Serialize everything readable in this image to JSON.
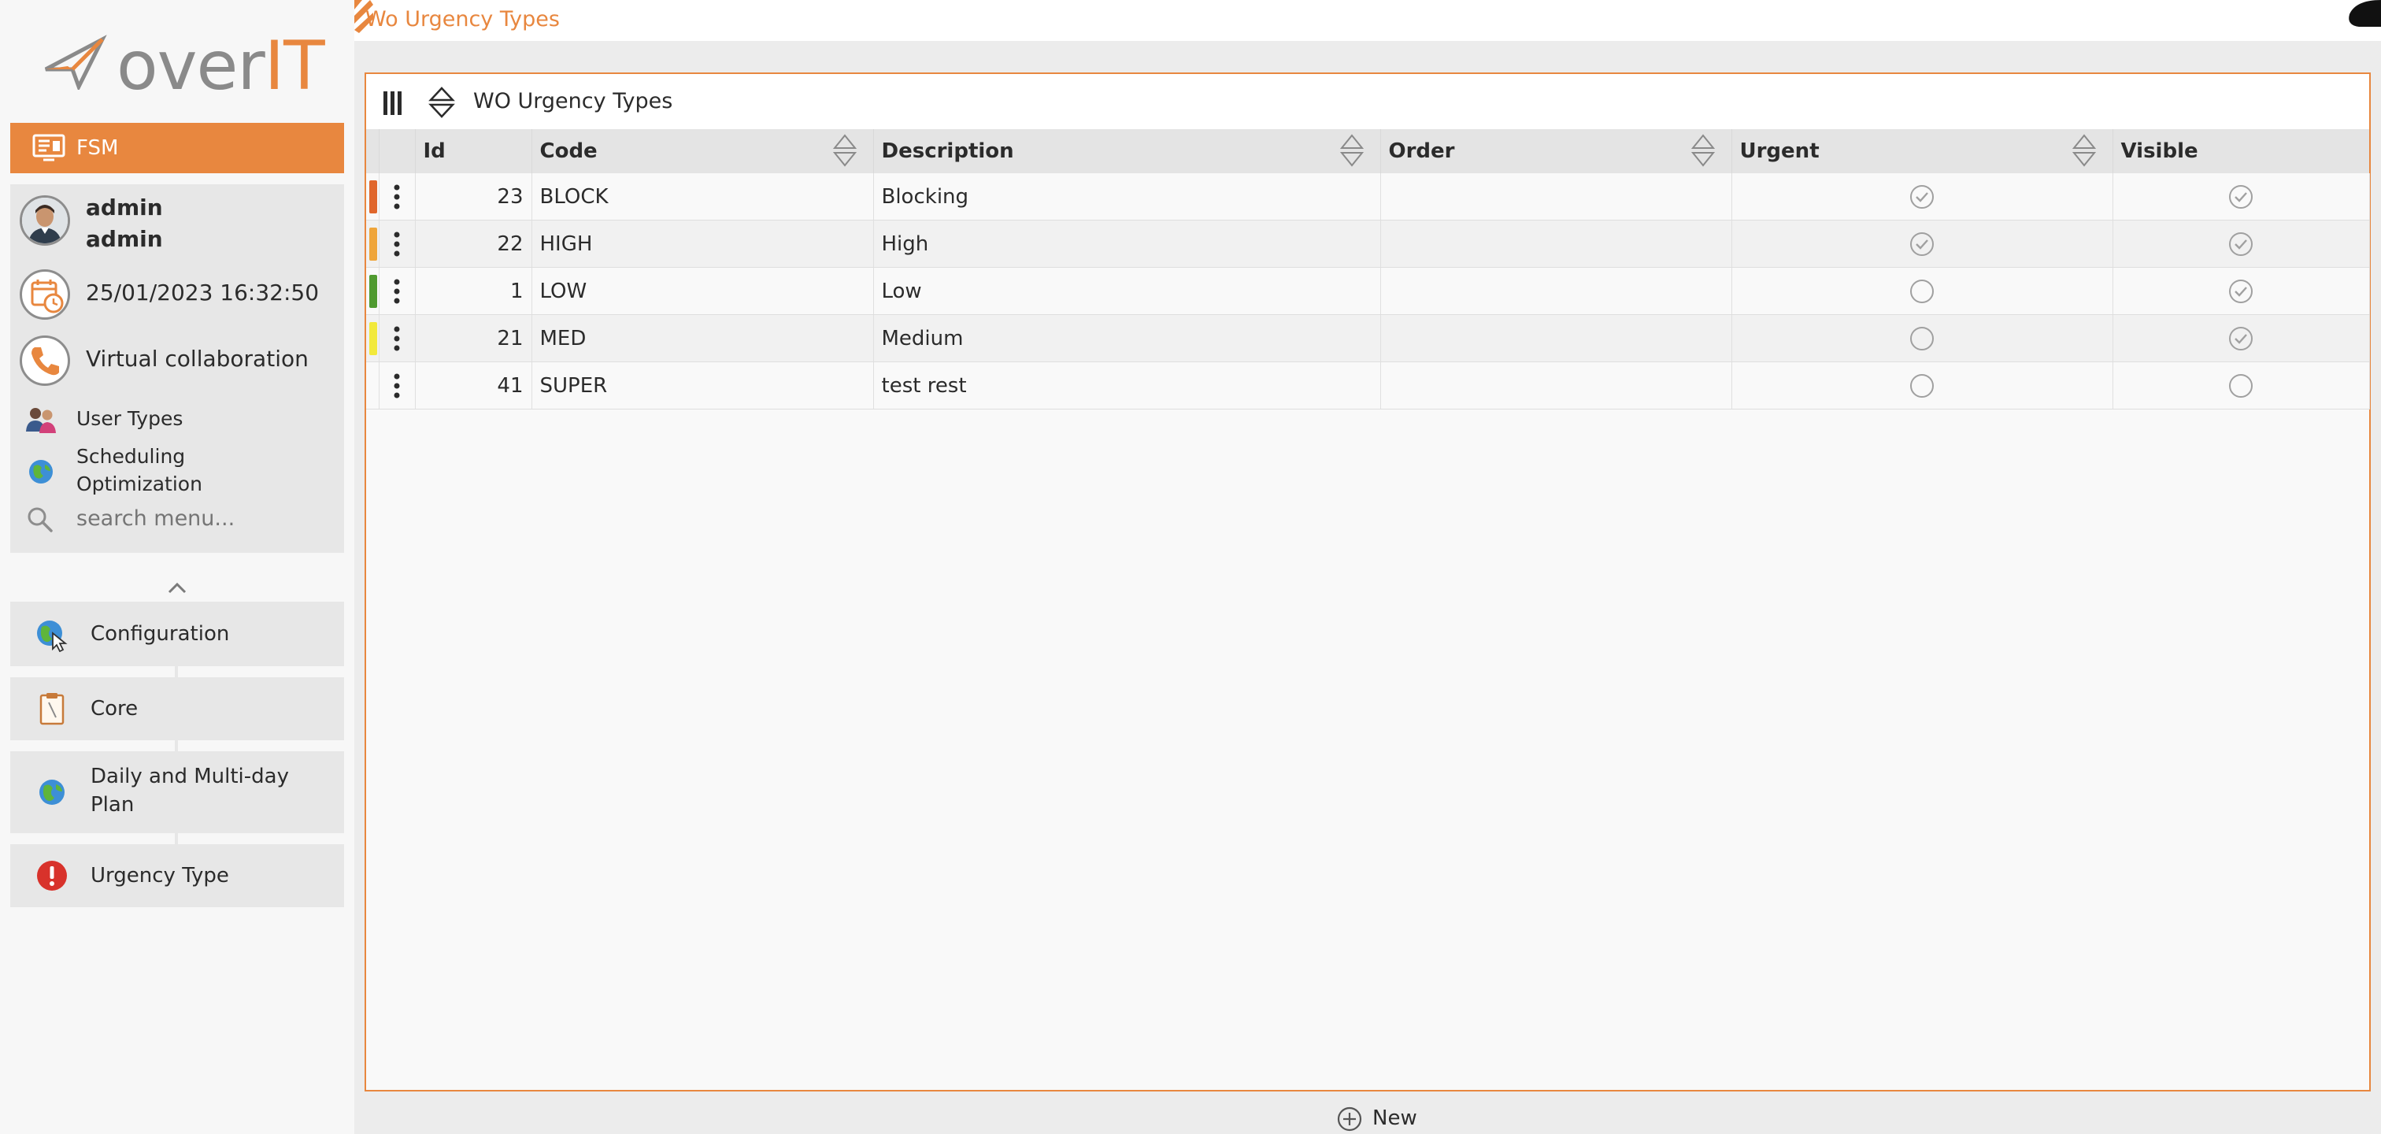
{
  "logo": {
    "brand_prefix": "over",
    "brand_suffix": "IT"
  },
  "module": {
    "label": "FSM"
  },
  "user": {
    "line1": "admin",
    "line2": "admin",
    "datetime": "25/01/2023 16:32:50",
    "collaboration": "Virtual collaboration"
  },
  "quick_menu": [
    {
      "label": "User Types",
      "icon": "users-icon"
    },
    {
      "label": "Scheduling Optimization",
      "icon": "globe-icon"
    }
  ],
  "search": {
    "placeholder": "search menu..."
  },
  "nav": [
    {
      "label": "Configuration",
      "icon": "globe-cursor-icon"
    },
    {
      "label": "Core",
      "icon": "clipboard-icon"
    },
    {
      "label": "Daily and Multi-day Plan",
      "icon": "globe-icon"
    },
    {
      "label": "Urgency Type",
      "icon": "exclamation-icon"
    }
  ],
  "breadcrumb": {
    "title": "Wo Urgency Types"
  },
  "panel": {
    "title": "WO Urgency Types"
  },
  "table": {
    "headers": {
      "id": "Id",
      "code": "Code",
      "description": "Description",
      "order": "Order",
      "urgent": "Urgent",
      "visible": "Visible"
    },
    "rows": [
      {
        "color": "#e0662c",
        "id": "23",
        "code": "BLOCK",
        "description": "Blocking",
        "order": "",
        "urgent": true,
        "visible": true
      },
      {
        "color": "#efa53a",
        "id": "22",
        "code": "HIGH",
        "description": "High",
        "order": "",
        "urgent": true,
        "visible": true
      },
      {
        "color": "#4f9a2f",
        "id": "1",
        "code": "LOW",
        "description": "Low",
        "order": "",
        "urgent": false,
        "visible": true
      },
      {
        "color": "#f2e93b",
        "id": "21",
        "code": "MED",
        "description": "Medium",
        "order": "",
        "urgent": false,
        "visible": true
      },
      {
        "color": "",
        "id": "41",
        "code": "SUPER",
        "description": "test rest",
        "order": "",
        "urgent": false,
        "visible": false
      }
    ]
  },
  "footer": {
    "new_label": "New"
  },
  "colors": {
    "accent": "#e8873f",
    "sidebar_bg": "#e7e7e7",
    "check_gray": "#9a9a9a"
  }
}
